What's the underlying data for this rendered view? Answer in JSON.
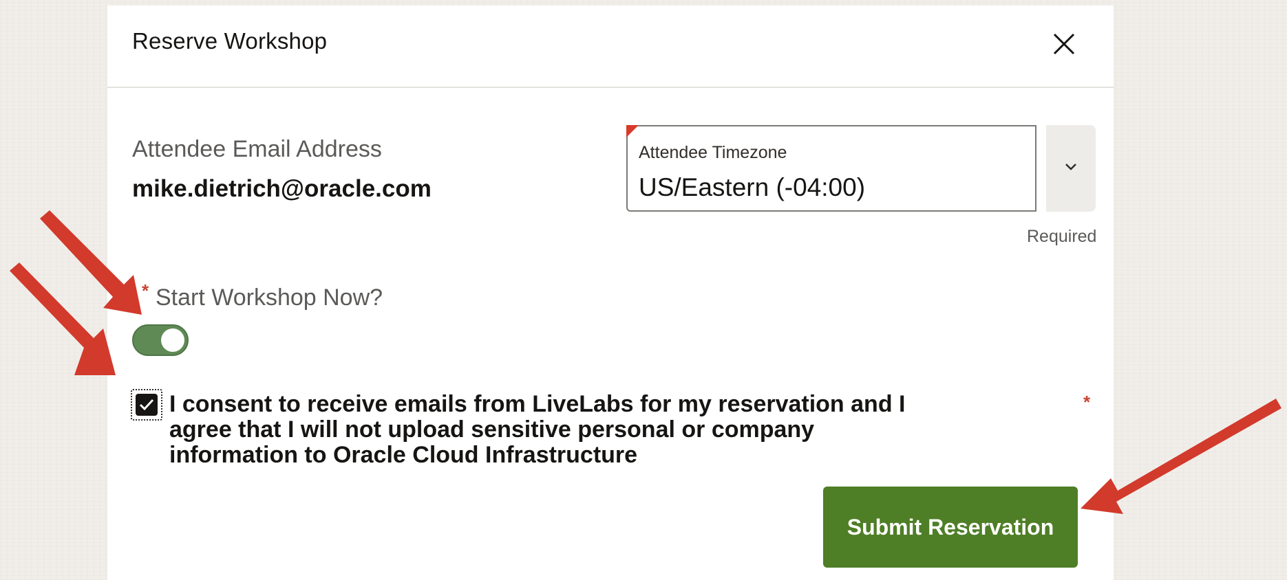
{
  "dialog": {
    "title": "Reserve Workshop",
    "close_icon": "close-icon"
  },
  "attendee": {
    "email_label": "Attendee Email Address",
    "email_value": "mike.dietrich@oracle.com"
  },
  "timezone": {
    "label": "Attendee Timezone",
    "value": "US/Eastern (-04:00)",
    "required_note": "Required",
    "dropdown_icon": "chevron-down-icon"
  },
  "start_now": {
    "required_marker": "*",
    "label": "Start Workshop Now?",
    "toggle_on": true
  },
  "consent": {
    "checked": true,
    "text": "I consent to receive emails from LiveLabs for my reservation and I agree that I will not upload sensitive personal or company information to Oracle Cloud Infrastructure",
    "required_marker": "*"
  },
  "actions": {
    "submit_label": "Submit Reservation"
  },
  "colors": {
    "submit_button": "#4e7e26",
    "toggle_on": "#5f8a55",
    "required_marker": "#c74634",
    "annotation_arrow": "#d23a2c"
  }
}
